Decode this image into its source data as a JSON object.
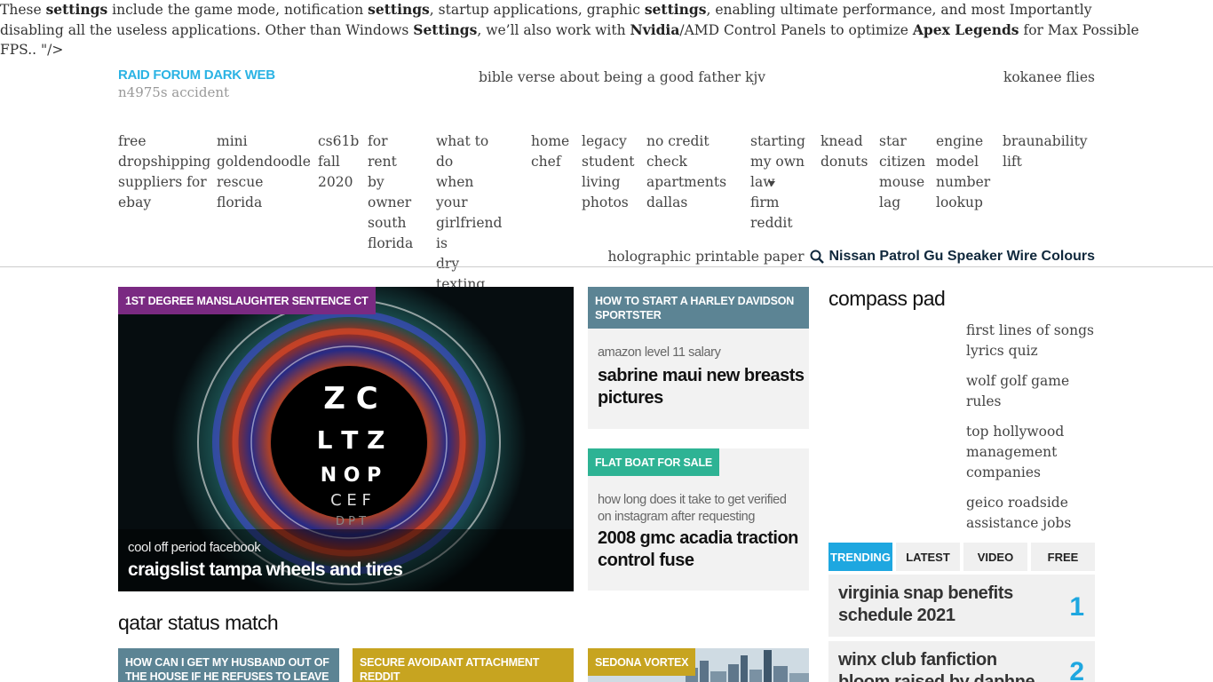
{
  "intro": {
    "seg1": "These ",
    "b1": "settings",
    "seg2": " include the game mode, notification ",
    "b2": "settings",
    "seg3": ", startup applications, graphic ",
    "b3": "settings",
    "seg4": ", enabling ultimate performance, and most Importantly disabling all the useless applications. Other than Windows ",
    "b4": "Settings",
    "seg5": ", we’ll also work with ",
    "b5": "Nvidia",
    "seg6": "/AMD Control Panels to optimize ",
    "b6": "Apex Legends",
    "seg7": " for Max Possible FPS.. \"/>"
  },
  "header": {
    "logo": "RAID FORUM DARK WEB",
    "logo_sub": "n4975s accident",
    "center_link": "bible verse about being a good father kjv",
    "right_link": "kokanee flies"
  },
  "nav": [
    {
      "lines": [
        "free",
        "dropshipping",
        "suppliers for",
        "ebay"
      ]
    },
    {
      "lines": [
        "mini",
        "goldendoodle",
        "rescue florida"
      ]
    },
    {
      "lines": [
        "cs61b",
        "fall",
        "2020"
      ]
    },
    {
      "lines": [
        "for rent",
        "by",
        "owner",
        "south",
        "florida"
      ]
    },
    {
      "lines": [
        "what to do",
        "when your",
        "girlfriend is",
        "dry texting"
      ]
    },
    {
      "lines": [
        "home",
        "chef"
      ]
    },
    {
      "lines": [
        "legacy",
        "student",
        "living",
        "photos"
      ]
    },
    {
      "lines": [
        "no credit",
        "check",
        "apartments",
        "dallas"
      ]
    },
    {
      "lines": [
        "starting",
        "my own",
        "law firm",
        "reddit"
      ]
    },
    {
      "lines": [
        "knead",
        "donuts"
      ]
    },
    {
      "lines": [
        "star",
        "citizen",
        "mouse",
        "lag"
      ]
    },
    {
      "lines": [
        "engine",
        "model",
        "number",
        "lookup"
      ]
    },
    {
      "lines": [
        "braunability",
        "lift"
      ]
    }
  ],
  "search": {
    "query": "holographic printable paper",
    "brand": "Nissan Patrol Gu Speaker Wire Colours",
    "icon": "search-icon"
  },
  "hero": {
    "tag": "1ST DEGREE MANSLAUGHTER SENTENCE CT",
    "sub": "cool off period facebook",
    "title": "craigslist tampa wheels and tires",
    "eye_chart": [
      "Z C",
      "L T Z",
      "N O P",
      "C E F",
      "D P T"
    ]
  },
  "side_cards": [
    {
      "tag": "HOW TO START A HARLEY DAVIDSON SPORTSTER",
      "sub": "amazon level 11 salary",
      "title": "sabrine maui new breasts pictures"
    },
    {
      "tag": "FLAT BOAT FOR SALE",
      "sub": "how long does it take to get verified on instagram after requesting",
      "title": "2008 gmc acadia traction control fuse"
    }
  ],
  "section_title": "qatar status match",
  "bottom_cards": [
    {
      "tag": "HOW CAN I GET MY HUSBAND OUT OF THE HOUSE IF HE REFUSES TO LEAVE"
    },
    {
      "tag": "SECURE AVOIDANT ATTACHMENT REDDIT"
    },
    {
      "tag": "SEDONA VORTEX"
    }
  ],
  "aside": {
    "title": "compass pad",
    "links": [
      "first lines of songs lyrics quiz",
      "wolf golf game rules",
      "top hollywood management companies",
      "geico roadside assistance jobs"
    ]
  },
  "tabs": [
    "TRENDING",
    "LATEST",
    "VIDEO",
    "FREE"
  ],
  "trending": [
    {
      "title": "virginia snap benefits schedule 2021",
      "num": "1"
    },
    {
      "title": "winx club fanfiction bloom raised by daphne",
      "num": "2"
    }
  ],
  "colors": {
    "accent": "#1ea7e0",
    "logo": "#2bb3e4",
    "hero_tag": "#7a2a82",
    "side_tag_1": "#5c8494",
    "side_tag_2": "#2eb394",
    "gold_tag": "#c7a420"
  }
}
